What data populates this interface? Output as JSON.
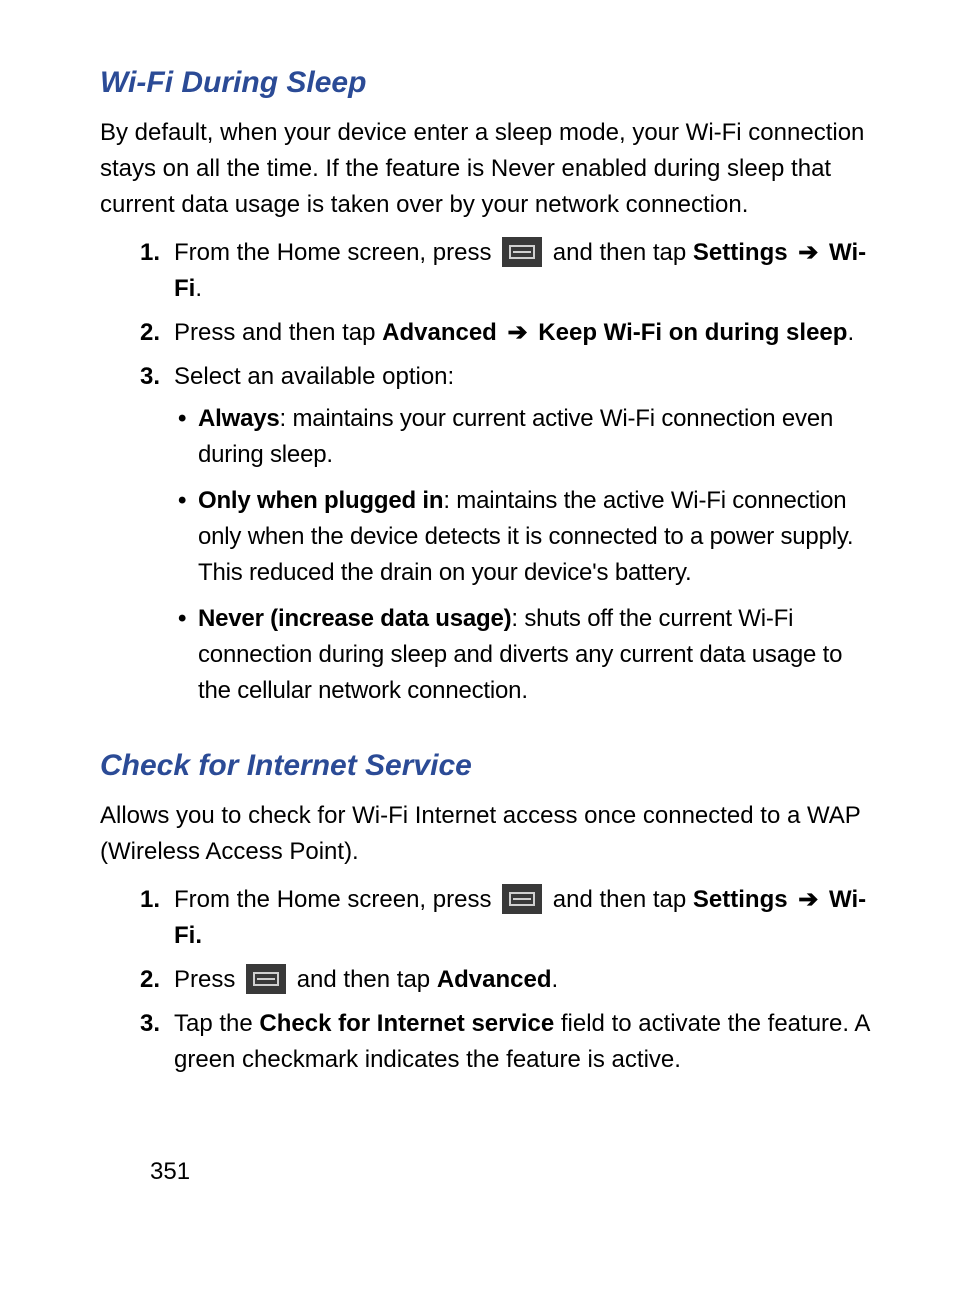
{
  "arrow_glyph": "➔",
  "section1": {
    "title": "Wi-Fi During Sleep",
    "intro": "By default, when your device enter a sleep mode, your Wi-Fi connection stays on all the time. If the feature is Never enabled during sleep that current data usage is taken over by your network connection.",
    "step1": {
      "num": "1.",
      "pre": "From the Home screen, press ",
      "post": " and then tap ",
      "settings": "Settings",
      "wifi": "Wi-Fi",
      "period": "."
    },
    "step2": {
      "num": "2.",
      "pre": "Press and then tap ",
      "advanced": "Advanced",
      "keep": "Keep Wi-Fi on during sleep",
      "period": "."
    },
    "step3": {
      "num": "3.",
      "text": "Select an available option:",
      "options": {
        "always": {
          "label": "Always",
          "desc": ": maintains your current active Wi-Fi connection even during sleep."
        },
        "plugged": {
          "label": "Only when plugged in",
          "desc": ": maintains the active Wi-Fi connection only when the device detects it is connected to a power supply. This reduced the drain on your device's battery."
        },
        "never": {
          "label": "Never (increase data usage)",
          "desc": ": shuts off the current Wi-Fi connection during sleep and diverts any current data usage to the cellular network connection."
        }
      }
    }
  },
  "section2": {
    "title": "Check for Internet Service",
    "intro": "Allows you to check for Wi-Fi Internet access once connected to a WAP (Wireless Access Point).",
    "step1": {
      "num": "1.",
      "pre": "From the Home screen, press ",
      "post": " and then tap ",
      "settings": "Settings",
      "wifi": "Wi-Fi."
    },
    "step2": {
      "num": "2.",
      "pre": "Press ",
      "post": " and then tap ",
      "advanced": "Advanced",
      "period": "."
    },
    "step3": {
      "num": "3.",
      "pre": "Tap the ",
      "field": "Check for Internet service",
      "post": " field to activate the feature. A green checkmark indicates the feature is active."
    }
  },
  "page_number": "351"
}
